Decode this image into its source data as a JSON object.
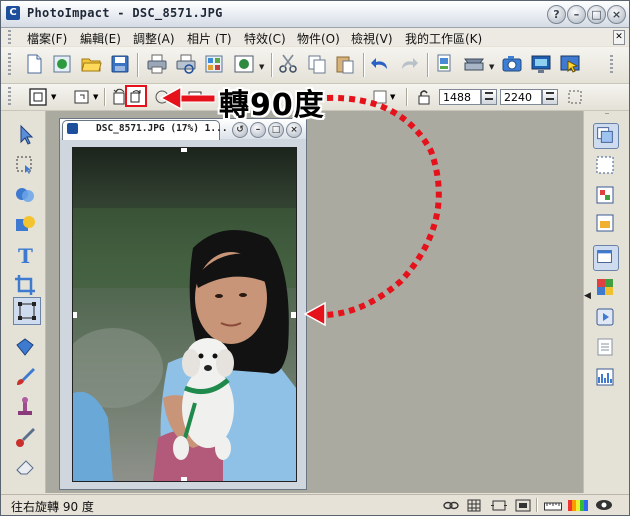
{
  "window": {
    "title": "PhotoImpact - DSC_8571.JPG",
    "app_icon": "C"
  },
  "menu": [
    {
      "label": "檔案(F)"
    },
    {
      "label": "編輯(E)"
    },
    {
      "label": "調整(A)"
    },
    {
      "label": "相片 (T)"
    },
    {
      "label": "特效(C)"
    },
    {
      "label": "物件(O)"
    },
    {
      "label": "檢視(V)"
    },
    {
      "label": "我的工作區(K)"
    }
  ],
  "toolbar2": {
    "width_value": "1488",
    "height_value": "2240"
  },
  "document": {
    "title": "DSC_8571.JPG (17%) 1..."
  },
  "annotation": {
    "label": "轉90度",
    "color": "#e5121b"
  },
  "status": {
    "text": "往右旋轉 90 度"
  },
  "colors": {
    "accent_red": "#e5121b",
    "workspace": "#abaaa1"
  }
}
